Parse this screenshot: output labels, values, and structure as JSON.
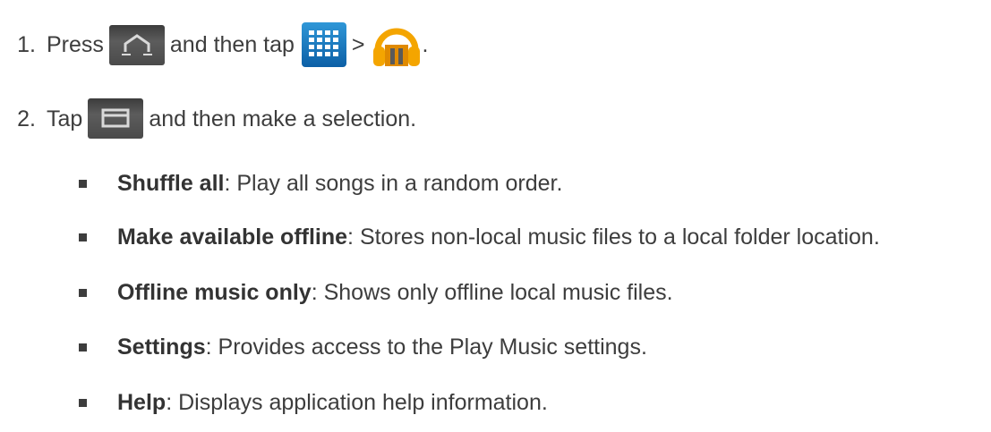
{
  "steps": [
    {
      "number": "1.",
      "text_before": "Press",
      "text_middle": "and then tap",
      "separator": ">",
      "text_end": ".",
      "icons": [
        "home-key-icon",
        "apps-grid-icon",
        "play-music-icon"
      ]
    },
    {
      "number": "2.",
      "text_before": "Tap",
      "text_after": "and then make a selection.",
      "icons": [
        "menu-key-icon"
      ]
    }
  ],
  "options": [
    {
      "term": "Shuffle all",
      "description": ": Play all songs in a random order."
    },
    {
      "term": "Make available offline",
      "description": ": Stores non-local music files to a local folder location."
    },
    {
      "term": "Offline music only",
      "description": ": Shows only offline local music files."
    },
    {
      "term": "Settings",
      "description": ": Provides access to the Play Music settings."
    },
    {
      "term": "Help",
      "description": ": Displays application help information."
    }
  ],
  "colors": {
    "text": "#3d3d3d",
    "grid_icon": "#1a78c2",
    "music_icon": "#f4a500"
  }
}
